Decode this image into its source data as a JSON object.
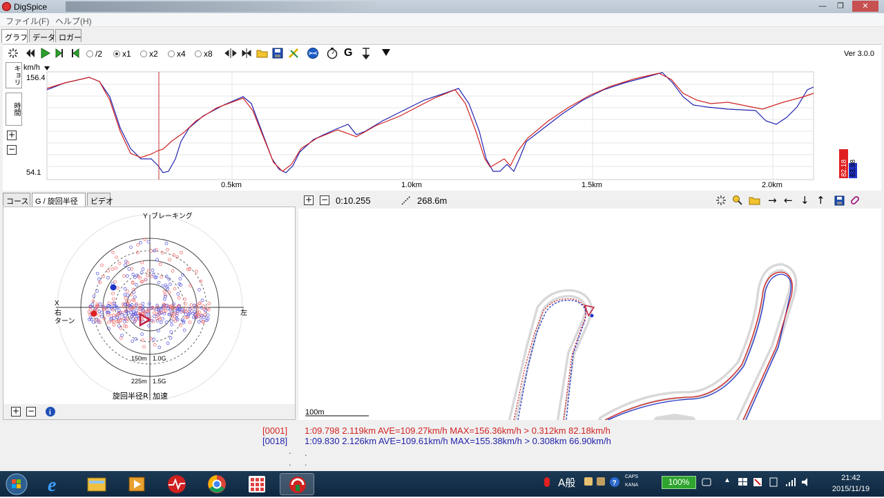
{
  "window": {
    "title": "DigSpice",
    "minimize": "—",
    "maximize": "❐",
    "close": "✕"
  },
  "menu": {
    "file": "ファイル(F)",
    "help": "ヘルプ(H)"
  },
  "tabs": [
    "グラフ",
    "データ",
    "ロガー"
  ],
  "toolbar": {
    "speeds": [
      {
        "label": "/2",
        "selected": false
      },
      {
        "label": "x1",
        "selected": true
      },
      {
        "label": "x2",
        "selected": false
      },
      {
        "label": "x4",
        "selected": false
      },
      {
        "label": "x8",
        "selected": false
      }
    ],
    "g_label": "G",
    "version": "Ver 3.0.0"
  },
  "graph": {
    "side_tabs": [
      "キョリ",
      "時間"
    ],
    "unit": "km/h",
    "ymax": "156.4",
    "ymin": "54.1",
    "x_labels": [
      "0.5km",
      "1.0km",
      "1.5km",
      "2.0km"
    ],
    "value_red": "82.18",
    "value_blue": "63.98"
  },
  "left_tabs": [
    "コース",
    "G / 旋回半径",
    "ビデオ"
  ],
  "gplot": {
    "y_axis": "Y",
    "braking": "ブレーキング",
    "x_axis": "X",
    "right": "右",
    "turn": "ターン",
    "left": "左",
    "ring1_radius": "150m",
    "ring1_g": "1.0G",
    "ring2_radius": "225m",
    "ring2_g": "1.5G",
    "radius_label": "旋回半径R",
    "accel_label": "加速"
  },
  "map": {
    "time": "0:10.255",
    "distance": "268.6m",
    "scale": "100m"
  },
  "laps": [
    {
      "id": "[0001]",
      "text": "1:09.798 2.119km AVE=109.27km/h MAX=156.36km/h > 0.312km 82.18km/h",
      "color": "#d22222"
    },
    {
      "id": "[0018]",
      "text": "1:09.830 2.126km AVE=109.61km/h MAX=155.38km/h > 0.308km 66.90km/h",
      "color": "#2222aa"
    }
  ],
  "taskbar": {
    "ime": "A般",
    "caps": "CAPS",
    "kana": "KANA",
    "battery": "100%",
    "time": "21:42",
    "date": "2015/11/19"
  }
}
